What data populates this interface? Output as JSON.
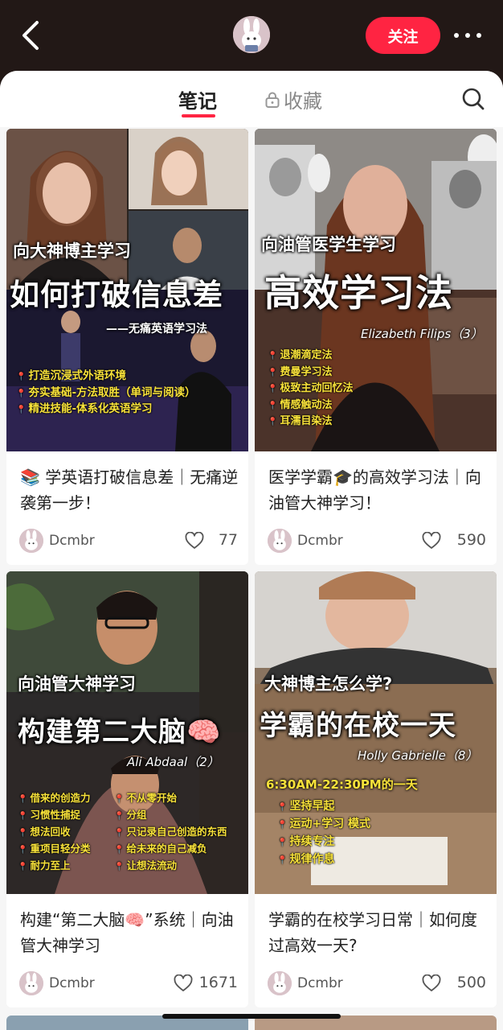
{
  "header": {
    "follow_label": "关注",
    "colors": {
      "accent": "#ff2442",
      "topbar": "#221816"
    }
  },
  "tabs": {
    "notes": "笔记",
    "favorites": "收藏"
  },
  "cards": [
    {
      "overlay": {
        "sub": "向大神博主学习",
        "main": "如何打破信息差",
        "tagline": "——无痛英语学习法",
        "list": [
          "打造沉浸式外语环境",
          "夯实基础-方法取胜（单词与阅读）",
          "精进技能-体系化英语学习"
        ]
      },
      "title": "📚 学英语打破信息差｜无痛逆袭第一步！",
      "author": "Dcmbr",
      "likes": "77"
    },
    {
      "overlay": {
        "sub": "向油管医学生学习",
        "main": "高效学习法",
        "name": "Elizabeth Filips（3）",
        "list": [
          "退潮滴定法",
          "费曼学习法",
          "极致主动回忆法",
          "情感触动法",
          "耳濡目染法"
        ]
      },
      "title": "医学学霸🎓的高效学习法｜向油管大神学习！",
      "author": "Dcmbr",
      "likes": "590"
    },
    {
      "overlay": {
        "sub": "向油管大神学习",
        "main": "构建第二大脑🧠",
        "name": "Ali Abdaal（2）",
        "list_left": [
          "借来的创造力",
          "习惯性捕捉",
          "想法回收",
          "重项目轻分类",
          "耐力至上"
        ],
        "list_right": [
          "不从零开始",
          "分组",
          "只记录自己创造的东西",
          "给未来的自己减负",
          "让想法流动"
        ]
      },
      "title": "构建“第二大脑🧠”系统｜向油管大神学习",
      "author": "Dcmbr",
      "likes": "1671"
    },
    {
      "overlay": {
        "sub": "大神博主怎么学?",
        "main": "学霸的在校一天",
        "name": "Holly Gabrielle（8）",
        "time": "6:30AM-22:30PM的一天",
        "list": [
          "坚持早起",
          "运动+学习 模式",
          "持续专注",
          "规律作息"
        ]
      },
      "title": "学霸的在校学习日常｜如何度过高效一天?",
      "author": "Dcmbr",
      "likes": "500"
    }
  ]
}
